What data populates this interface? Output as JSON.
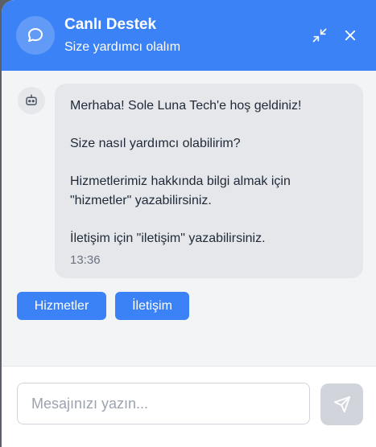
{
  "header": {
    "title": "Canlı Destek",
    "subtitle": "Size yardımcı olalım",
    "avatar_icon": "chat-bubble-icon",
    "minimize_icon": "minimize-arrows-icon",
    "close_icon": "close-icon"
  },
  "messages": [
    {
      "sender": "bot",
      "avatar_icon": "robot-icon",
      "lines": [
        "Merhaba! Sole Luna Tech'e hoş geldiniz!",
        "Size nasıl yardımcı olabilirim?",
        "Hizmetlerimiz hakkında bilgi almak için \"hizmetler\" yazabilirsiniz.",
        "İletişim için \"iletişim\" yazabilirsiniz."
      ],
      "time": "13:36"
    }
  ],
  "quick_replies": [
    "Hizmetler",
    "İletişim"
  ],
  "composer": {
    "placeholder": "Mesajınızı yazın...",
    "value": "",
    "send_icon": "send-icon"
  },
  "colors": {
    "accent": "#3b82f6",
    "bubble": "#e5e7eb",
    "panel": "#f3f4f6",
    "send_disabled": "#d1d5db"
  }
}
